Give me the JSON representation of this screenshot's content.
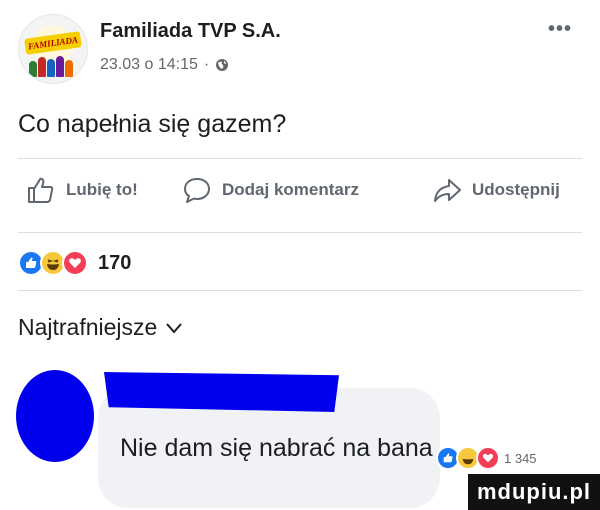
{
  "post": {
    "page_name": "Familiada TVP S.A.",
    "date": "23.03 o 14:15",
    "separator": "·",
    "text": "Co napełnia się gazem?",
    "avatar_logo_text": "FAMILIADA"
  },
  "actions": {
    "like_label": "Lubię to!",
    "comment_label": "Dodaj komentarz",
    "share_label": "Udostępnij"
  },
  "reactions": {
    "count": "170",
    "types": [
      "like-icon",
      "haha-icon",
      "love-icon"
    ]
  },
  "comments": {
    "sort_label": "Najtrafniejsze",
    "items": [
      {
        "author": "",
        "text": "Nie dam się nabrać na bana",
        "reaction_count": "1 345"
      }
    ]
  },
  "watermark": "mdupiu.pl",
  "colors": {
    "text_primary": "#1c1e21",
    "text_secondary": "#65676b",
    "like_blue": "#1877f2",
    "love_red": "#f33e58",
    "haha_yellow": "#f7c83b",
    "bubble_gray": "#f0f2f5",
    "redaction_blue": "#0000ee"
  }
}
